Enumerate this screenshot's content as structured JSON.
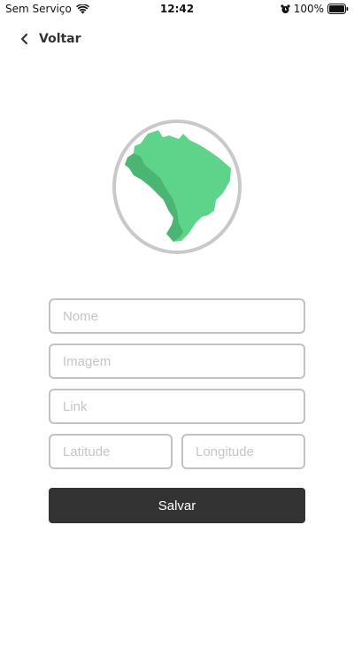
{
  "status_bar": {
    "carrier": "Sem Serviço",
    "time": "12:42",
    "battery": "100%"
  },
  "header": {
    "back_label": "Voltar",
    "back_icon": "chevron-left-icon"
  },
  "logo": {
    "icon": "brazil-map-icon",
    "map_color": "#5ed38a",
    "map_shadow_color": "#4bb574",
    "ring_color": "#c9c9c9"
  },
  "form": {
    "name_placeholder": "Nome",
    "name_value": "",
    "image_placeholder": "Imagem",
    "image_value": "",
    "link_placeholder": "Link",
    "link_value": "",
    "latitude_placeholder": "Latitude",
    "latitude_value": "",
    "longitude_placeholder": "Longitude",
    "longitude_value": "",
    "save_label": "Salvar"
  },
  "colors": {
    "primary_button": "#333333",
    "field_border": "#c2c2c2",
    "placeholder": "#c5c5c5"
  }
}
